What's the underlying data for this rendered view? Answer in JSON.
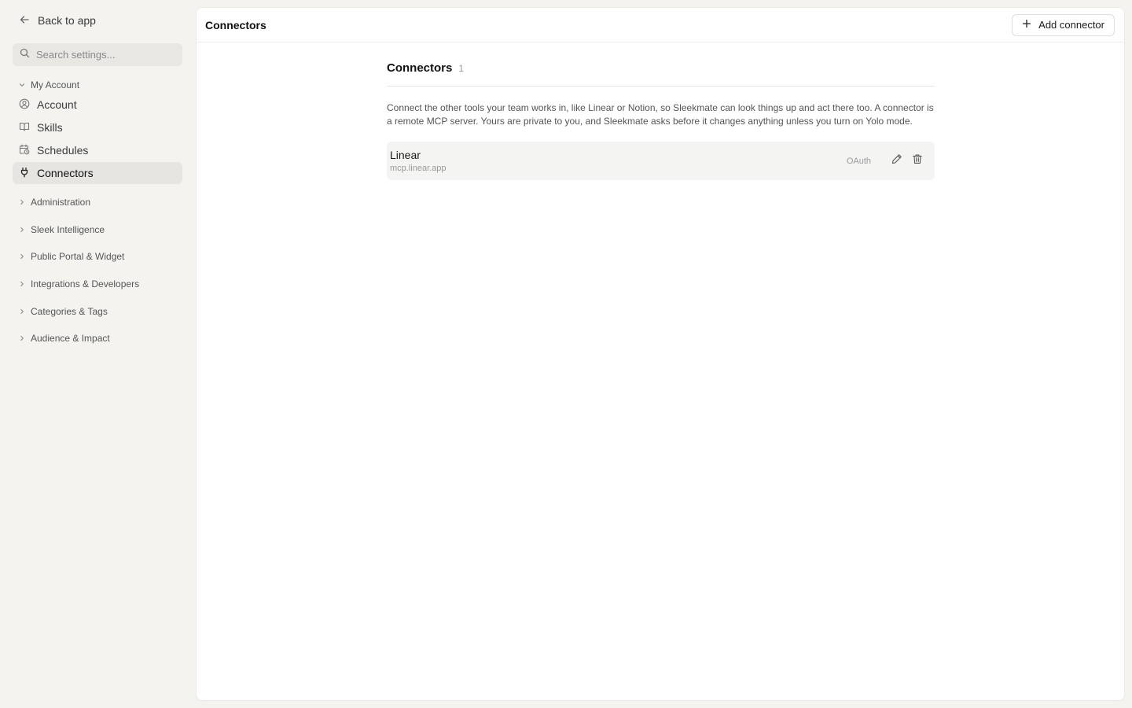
{
  "sidebar": {
    "back_label": "Back to app",
    "search_placeholder": "Search settings...",
    "my_account": {
      "label": "My Account",
      "items": [
        {
          "label": "Account",
          "icon": "user-circle-icon"
        },
        {
          "label": "Skills",
          "icon": "book-icon"
        },
        {
          "label": "Schedules",
          "icon": "calendar-clock-icon"
        },
        {
          "label": "Connectors",
          "icon": "plug-icon",
          "active": true
        }
      ]
    },
    "sections": [
      {
        "label": "Administration"
      },
      {
        "label": "Sleek Intelligence"
      },
      {
        "label": "Public Portal & Widget"
      },
      {
        "label": "Integrations & Developers"
      },
      {
        "label": "Categories & Tags"
      },
      {
        "label": "Audience & Impact"
      }
    ]
  },
  "header": {
    "title": "Connectors",
    "add_button_label": "Add connector"
  },
  "content": {
    "title": "Connectors",
    "count": "1",
    "description": "Connect the other tools your team works in, like Linear or Notion, so Sleekmate can look things up and act there too. A connector is a remote MCP server. Yours are private to you, and Sleekmate asks before it changes anything unless you turn on Yolo mode.",
    "connectors": [
      {
        "name": "Linear",
        "url": "mcp.linear.app",
        "auth": "OAuth"
      }
    ]
  },
  "colors": {
    "sidebar_bg": "#f4f3f0",
    "active_item_bg": "#e6e5e2",
    "panel_bg": "#ffffff",
    "card_bg": "#f4f4f3",
    "muted_text": "#9a9a9a"
  }
}
